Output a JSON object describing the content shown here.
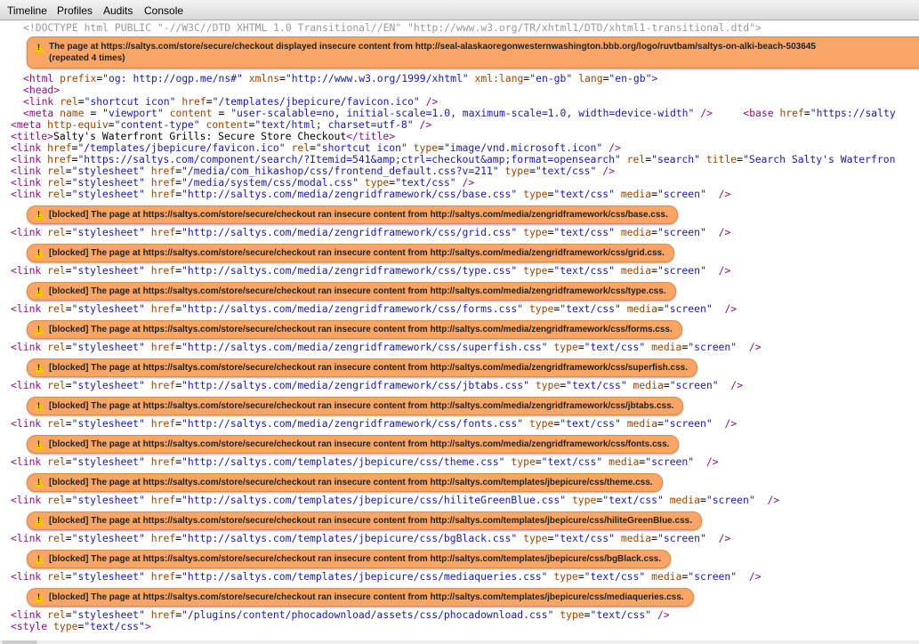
{
  "tabs": [
    "Timeline",
    "Profiles",
    "Audits",
    "Console"
  ],
  "doctype": "<!DOCTYPE html PUBLIC \"-//W3C//DTD XHTML 1.0 Transitional//EN\" \"http://www.w3.org/TR/xhtml1/DTD/xhtml1-transitional.dtd\">",
  "top_warning": {
    "line1": "The page at https://saltys.com/store/secure/checkout displayed insecure content from http://seal-alaskaoregonwesternwashington.bbb.org/logo/ruvtbam/saltys-on-alki-beach-503645",
    "line2": "(repeated 4 times)"
  },
  "head_lines": [
    "<html prefix=\"og: http://ogp.me/ns#\" xmlns=\"http://www.w3.org/1999/xhtml\" xml:lang=\"en-gb\" lang=\"en-gb\">",
    "<head>",
    "<link rel=\"shortcut icon\" href=\"/templates/jbepicure/favicon.ico\" />",
    "<meta name = \"viewport\" content = \"user-scalable=no, initial-scale=1.0, maximum-scale=1.0, width=device-width\" />     <base href=\"https://salty",
    "<meta http-equiv=\"content-type\" content=\"text/html; charset=utf-8\" />",
    "<title>Salty's Waterfront Grills: Secure Store Checkout</title>",
    "<link href=\"/templates/jbepicure/favicon.ico\" rel=\"shortcut icon\" type=\"image/vnd.microsoft.icon\" />",
    "<link href=\"https://saltys.com/component/search/?Itemid=541&amp;ctrl=checkout&amp;format=opensearch\" rel=\"search\" title=\"Search Salty's Waterfron",
    "<link rel=\"stylesheet\" href=\"/media/com_hikashop/css/frontend_default.css?v=211\" type=\"text/css\" />",
    "<link rel=\"stylesheet\" href=\"/media/system/css/modal.css\" type=\"text/css\" />"
  ],
  "blocked_pairs": [
    {
      "code": "<link rel=\"stylesheet\" href=\"http://saltys.com/media/zengridframework/css/base.css\" type=\"text/css\" media=\"screen\"  />",
      "warning": "[blocked] The page at https://saltys.com/store/secure/checkout ran insecure content from http://saltys.com/media/zengridframework/css/base.css."
    },
    {
      "code": "<link rel=\"stylesheet\" href=\"http://saltys.com/media/zengridframework/css/grid.css\" type=\"text/css\" media=\"screen\"  />",
      "warning": "[blocked] The page at https://saltys.com/store/secure/checkout ran insecure content from http://saltys.com/media/zengridframework/css/grid.css."
    },
    {
      "code": "<link rel=\"stylesheet\" href=\"http://saltys.com/media/zengridframework/css/type.css\" type=\"text/css\" media=\"screen\"  />",
      "warning": "[blocked] The page at https://saltys.com/store/secure/checkout ran insecure content from http://saltys.com/media/zengridframework/css/type.css."
    },
    {
      "code": "<link rel=\"stylesheet\" href=\"http://saltys.com/media/zengridframework/css/forms.css\" type=\"text/css\" media=\"screen\"  />",
      "warning": "[blocked] The page at https://saltys.com/store/secure/checkout ran insecure content from http://saltys.com/media/zengridframework/css/forms.css."
    },
    {
      "code": "<link rel=\"stylesheet\" href=\"http://saltys.com/media/zengridframework/css/superfish.css\" type=\"text/css\" media=\"screen\"  />",
      "warning": "[blocked] The page at https://saltys.com/store/secure/checkout ran insecure content from http://saltys.com/media/zengridframework/css/superfish.css."
    },
    {
      "code": "<link rel=\"stylesheet\" href=\"http://saltys.com/media/zengridframework/css/jbtabs.css\" type=\"text/css\" media=\"screen\"  />",
      "warning": "[blocked] The page at https://saltys.com/store/secure/checkout ran insecure content from http://saltys.com/media/zengridframework/css/jbtabs.css."
    },
    {
      "code": "<link rel=\"stylesheet\" href=\"http://saltys.com/media/zengridframework/css/fonts.css\" type=\"text/css\" media=\"screen\"  />",
      "warning": "[blocked] The page at https://saltys.com/store/secure/checkout ran insecure content from http://saltys.com/media/zengridframework/css/fonts.css."
    },
    {
      "code": "<link rel=\"stylesheet\" href=\"http://saltys.com/templates/jbepicure/css/theme.css\" type=\"text/css\" media=\"screen\"  />",
      "warning": "[blocked] The page at https://saltys.com/store/secure/checkout ran insecure content from http://saltys.com/templates/jbepicure/css/theme.css."
    },
    {
      "code": "<link rel=\"stylesheet\" href=\"http://saltys.com/templates/jbepicure/css/hiliteGreenBlue.css\" type=\"text/css\" media=\"screen\"  />",
      "warning": "[blocked] The page at https://saltys.com/store/secure/checkout ran insecure content from http://saltys.com/templates/jbepicure/css/hiliteGreenBlue.css."
    },
    {
      "code": "<link rel=\"stylesheet\" href=\"http://saltys.com/templates/jbepicure/css/bgBlack.css\" type=\"text/css\" media=\"screen\"  />",
      "warning": "[blocked] The page at https://saltys.com/store/secure/checkout ran insecure content from http://saltys.com/templates/jbepicure/css/bgBlack.css."
    },
    {
      "code": "<link rel=\"stylesheet\" href=\"http://saltys.com/templates/jbepicure/css/mediaqueries.css\" type=\"text/css\" media=\"screen\"  />",
      "warning": "[blocked] The page at https://saltys.com/store/secure/checkout ran insecure content from http://saltys.com/templates/jbepicure/css/mediaqueries.css."
    }
  ],
  "tail_lines": [
    "<link rel=\"stylesheet\" href=\"/plugins/content/phocadownload/assets/css/phocadownload.css\" type=\"text/css\" />",
    "<style type=\"text/css\">"
  ]
}
